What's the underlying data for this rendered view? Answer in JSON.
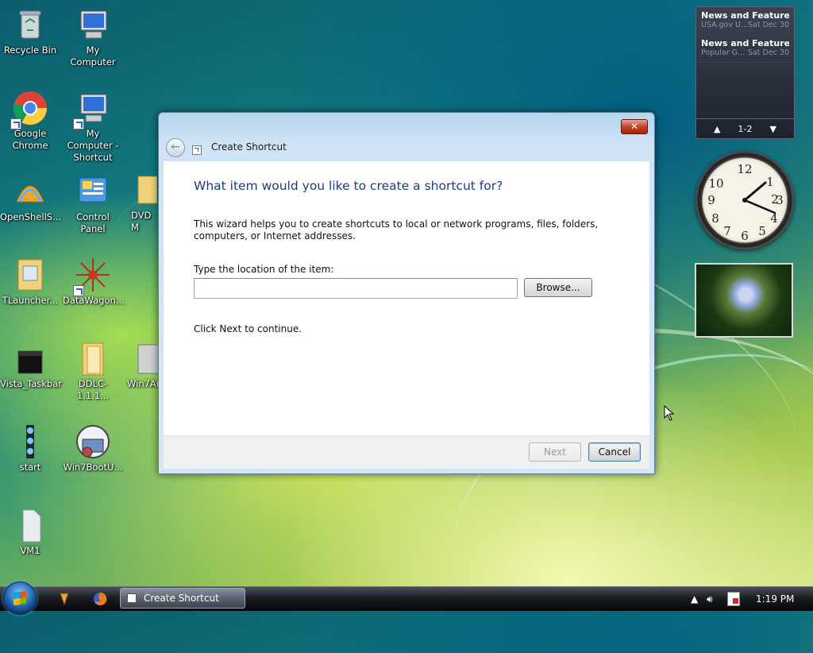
{
  "desktop": {
    "icons": [
      {
        "label": "Recycle Bin",
        "icon": "recycle-bin-icon"
      },
      {
        "label": "My Computer",
        "icon": "computer-icon"
      },
      {
        "label": "Google Chrome",
        "icon": "chrome-icon"
      },
      {
        "label": "My Computer - Shortcut",
        "icon": "computer-icon"
      },
      {
        "label": "OpenShellS...",
        "icon": "openshell-icon"
      },
      {
        "label": "Control Panel",
        "icon": "control-panel-icon"
      },
      {
        "label": "DVD M",
        "icon": "folder-icon"
      },
      {
        "label": "TLauncher...",
        "icon": "folder-icon"
      },
      {
        "label": "DataWagon...",
        "icon": "datawagon-icon"
      },
      {
        "label": "Vista_Taskbar",
        "icon": "taskbar-image-icon"
      },
      {
        "label": "DDLC-1.1.1...",
        "icon": "folder-icon"
      },
      {
        "label": "Win7Ar",
        "icon": "archive-icon"
      },
      {
        "label": "start",
        "icon": "start-image-icon"
      },
      {
        "label": "Win7BootU...",
        "icon": "boot-updater-icon"
      },
      {
        "label": "VM1",
        "icon": "file-icon"
      }
    ]
  },
  "gadgets": {
    "feeds": [
      {
        "title": "News and Features f...",
        "source": "USA.gov U...",
        "date": "Sat Dec 30"
      },
      {
        "title": "News and Feature...",
        "source": "Popular G...",
        "date": "Sat Dec 30"
      }
    ],
    "feed_page": "1-2"
  },
  "dialog": {
    "title": "Create Shortcut",
    "close_label": "✕",
    "heading": "What item would you like to create a shortcut for?",
    "description": "This wizard helps you to create shortcuts to local or network programs, files, folders, computers, or Internet addresses.",
    "location_label": "Type the location of the item:",
    "location_value": "",
    "browse_label": "Browse...",
    "continue_text": "Click Next to continue.",
    "next_label": "Next",
    "cancel_label": "Cancel"
  },
  "taskbar": {
    "task_button_label": "Create Shortcut",
    "time": "1:19 PM"
  }
}
